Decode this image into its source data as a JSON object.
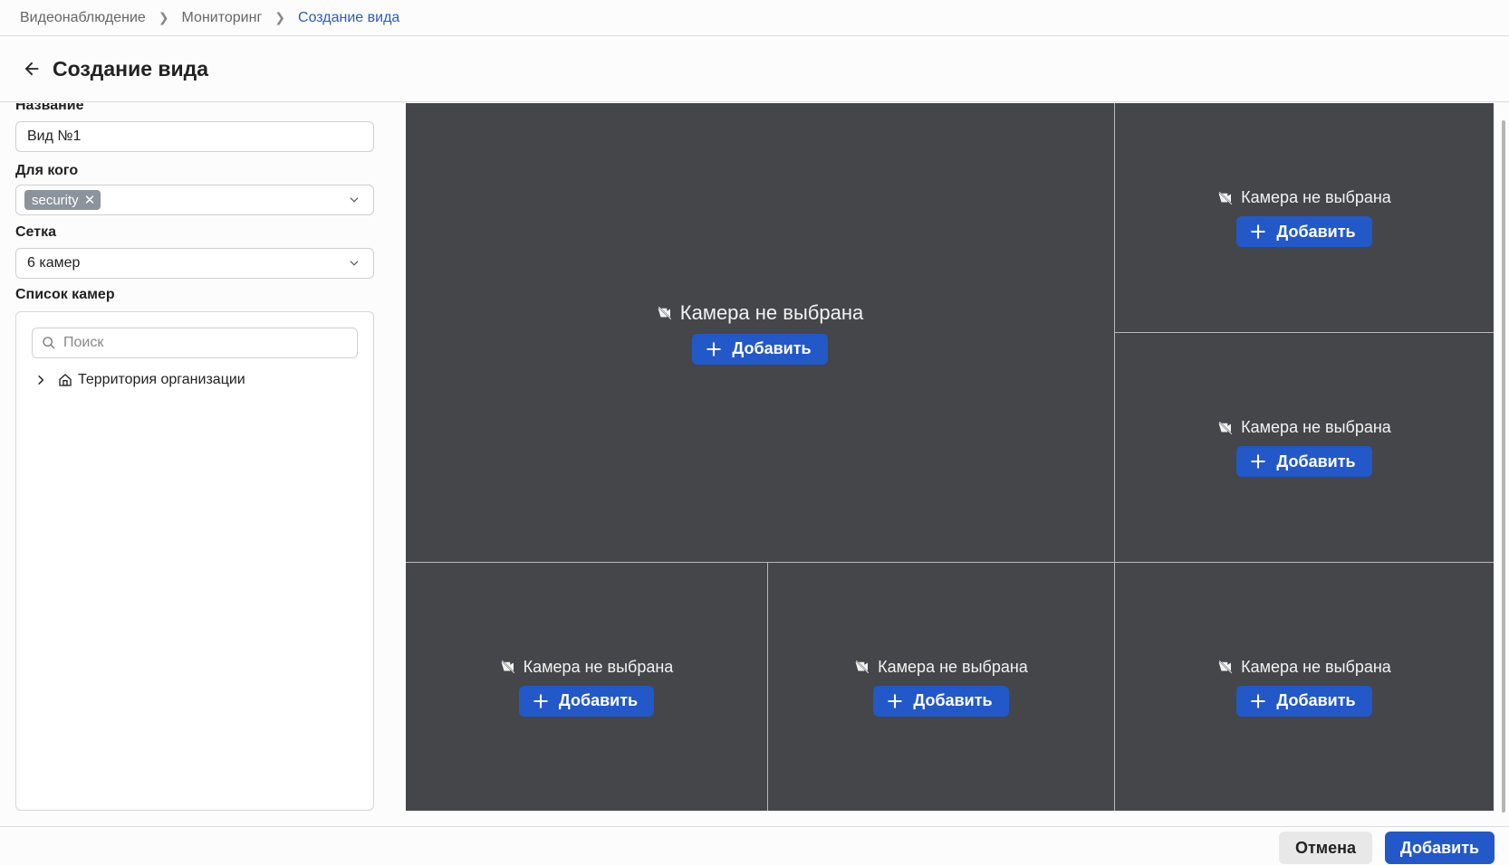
{
  "breadcrumb": {
    "items": [
      "Видеонаблюдение",
      "Мониторинг",
      "Создание вида"
    ]
  },
  "page": {
    "title": "Создание вида"
  },
  "form": {
    "name_label": "Название",
    "name_value": "Вид №1",
    "for_whom_label": "Для кого",
    "for_whom_chip": "security",
    "grid_label": "Сетка",
    "grid_value": "6 камер",
    "camera_list_label": "Список камер",
    "search_placeholder": "Поиск",
    "tree_root": "Территория организации"
  },
  "grid": {
    "cells": [
      {
        "message": "Камера не выбрана",
        "button": "Добавить"
      },
      {
        "message": "Камера не выбрана",
        "button": "Добавить"
      },
      {
        "message": "Камера не выбрана",
        "button": "Добавить"
      },
      {
        "message": "Камера не выбрана",
        "button": "Добавить"
      },
      {
        "message": "Камера не выбрана",
        "button": "Добавить"
      },
      {
        "message": "Камера не выбрана",
        "button": "Добавить"
      }
    ]
  },
  "footer": {
    "cancel": "Отмена",
    "submit": "Добавить"
  },
  "icons": {
    "back": "arrow-left-icon",
    "camera_off": "camera-off-icon",
    "plus": "plus-icon",
    "home": "home-icon",
    "search": "search-icon",
    "chevron": "chevron-down-icon"
  },
  "colors": {
    "accent": "#2358c9",
    "grid_bg": "#45464a",
    "chip_bg": "#8b939c",
    "link": "#2b5cb8"
  }
}
